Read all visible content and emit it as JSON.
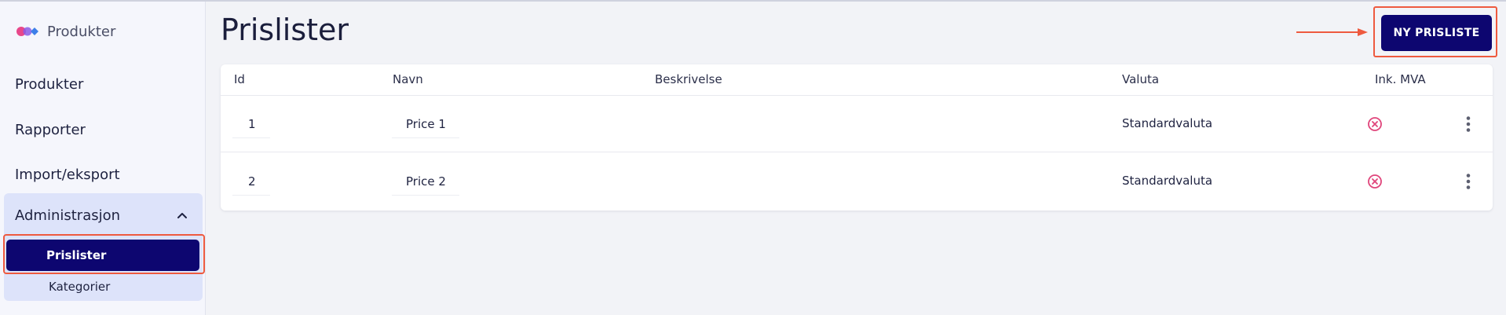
{
  "brand": {
    "label": "Produkter",
    "logo_icon": "brand-dots-icon"
  },
  "sidebar": {
    "items": [
      {
        "label": "Produkter"
      },
      {
        "label": "Rapporter"
      },
      {
        "label": "Import/eksport"
      }
    ],
    "group": {
      "label": "Administrasjon",
      "expanded_icon": "chevron-up-icon",
      "subitems": [
        {
          "label": "Prislister",
          "active": true
        },
        {
          "label": "Kategorier",
          "active": false
        }
      ]
    }
  },
  "main": {
    "title": "Prislister",
    "new_button_label": "NY PRISLISTE"
  },
  "table": {
    "columns": [
      "Id",
      "Navn",
      "Beskrivelse",
      "Valuta",
      "Ink. MVA"
    ],
    "rows": [
      {
        "id": "1",
        "name": "Price 1",
        "description": "",
        "currency": "Standardvaluta",
        "vat_icon": "x-circle-icon"
      },
      {
        "id": "2",
        "name": "Price 2",
        "description": "",
        "currency": "Standardvaluta",
        "vat_icon": "x-circle-icon"
      }
    ]
  },
  "colors": {
    "primary": "#0d0670",
    "highlight": "#ee5a3f",
    "negative_icon": "#e0457b",
    "sidebar_group_bg": "#dde3fa"
  }
}
